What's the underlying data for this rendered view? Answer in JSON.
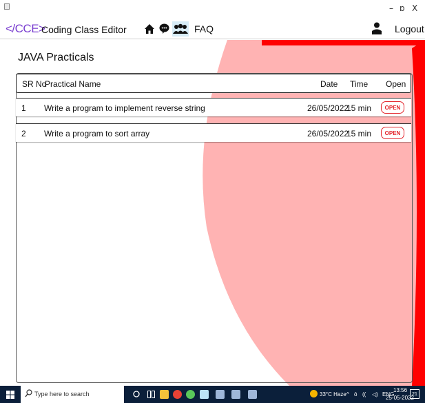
{
  "window": {
    "minimize": "–",
    "restore": "ɒ",
    "close": "X"
  },
  "header": {
    "logo": "</CCE>",
    "brand": "Coding Class Editor",
    "faq": "FAQ",
    "logout": "Logout"
  },
  "page": {
    "title": "JAVA Practicals"
  },
  "table": {
    "columns": {
      "sr": "SR No",
      "name": "Practical Name",
      "date": "Date",
      "time": "Time",
      "open": "Open"
    },
    "rows": [
      {
        "sr": "1",
        "name": "Write a program to implement reverse string",
        "date": "26/05/2022",
        "time": "15 min",
        "action": "OPEN"
      },
      {
        "sr": "2",
        "name": "Write a program to sort array",
        "date": "26/05/2022",
        "time": "15 min",
        "action": "OPEN"
      }
    ]
  },
  "taskbar": {
    "search_placeholder": "Type here to search",
    "weather": "33°C Haze",
    "lang": "ENG",
    "time": "13:56",
    "date": "25-05-2022",
    "notif_count": "21"
  },
  "colors": {
    "accent_red": "#ff0000",
    "soft_pink": "#ffb3b3",
    "logo_purple": "#7a3fd0",
    "open_red": "#e3242b",
    "taskbar": "#0b1f3a"
  },
  "icons": [
    "home-icon",
    "chat-icon",
    "group-icon",
    "user-icon",
    "windows-start-icon",
    "search-icon"
  ]
}
